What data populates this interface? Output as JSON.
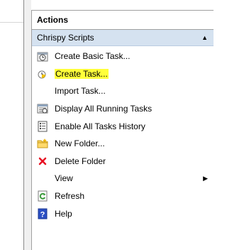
{
  "actions_pane": {
    "header": "Actions",
    "section": {
      "title": "Chrispy Scripts",
      "collapse_glyph": "▲"
    },
    "items": [
      {
        "label": "Create Basic Task...",
        "icon": "clock-icon"
      },
      {
        "label": "Create Task...",
        "icon": "clock-task-icon",
        "highlight_color": "#ffff3a"
      },
      {
        "label": "Import Task...",
        "icon": "none"
      },
      {
        "label": "Display All Running Tasks",
        "icon": "running-tasks-icon"
      },
      {
        "label": "Enable All Tasks History",
        "icon": "history-icon"
      },
      {
        "label": "New Folder...",
        "icon": "folder-icon"
      },
      {
        "label": "Delete Folder",
        "icon": "delete-x-icon",
        "icon_color": "#e81123"
      },
      {
        "label": "View",
        "icon": "none",
        "submenu_glyph": "▶"
      },
      {
        "label": "Refresh",
        "icon": "refresh-icon",
        "icon_color": "#3a9a3a"
      },
      {
        "label": "Help",
        "icon": "help-icon",
        "icon_color": "#2b4fc4"
      }
    ]
  }
}
